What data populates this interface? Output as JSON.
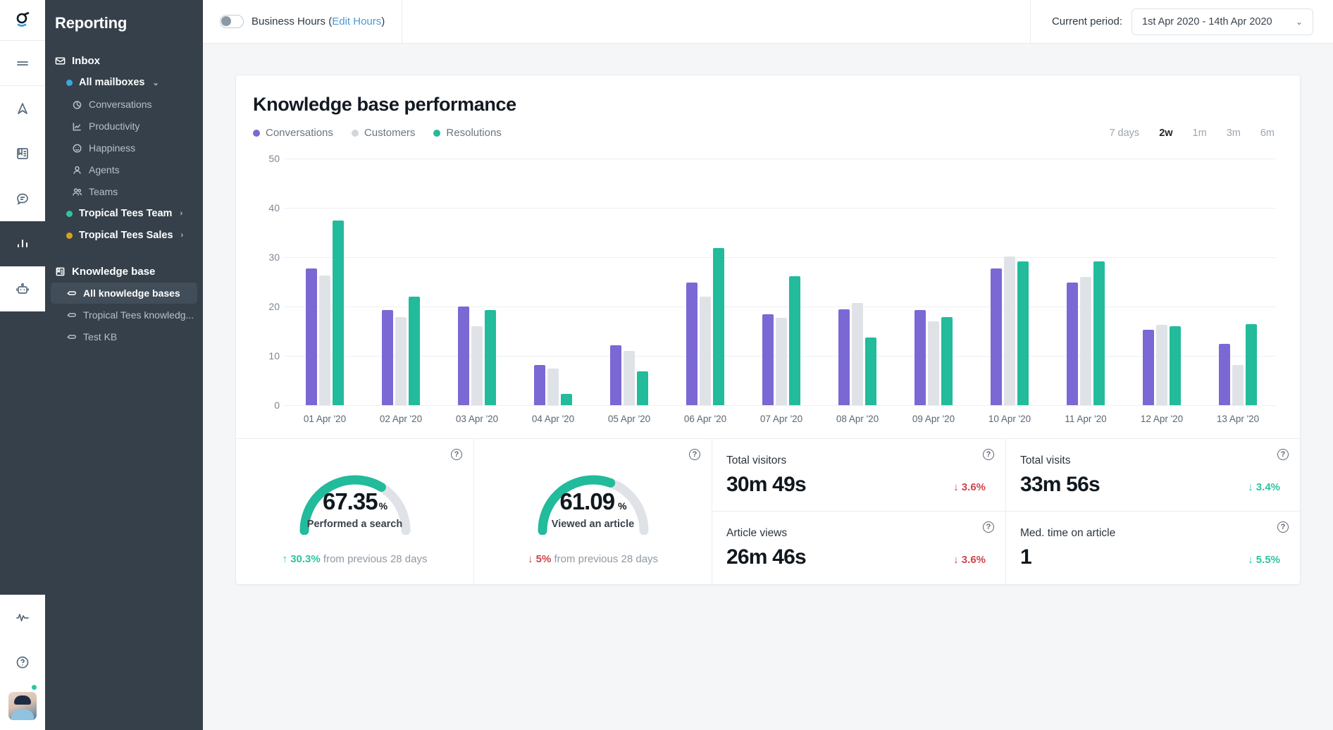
{
  "rail": {
    "items": [
      {
        "name": "logo",
        "icon": "helpscout-logo"
      },
      {
        "name": "menu",
        "icon": "hamburger-icon"
      },
      {
        "name": "navigation",
        "icon": "navigate-icon"
      },
      {
        "name": "docs",
        "icon": "book-icon"
      },
      {
        "name": "chat",
        "icon": "chat-bubble-icon"
      },
      {
        "name": "reports",
        "icon": "bar-chart-icon",
        "active": true
      },
      {
        "name": "beacon",
        "icon": "robot-icon"
      }
    ],
    "bottom": [
      {
        "name": "activity",
        "icon": "pulse-icon"
      },
      {
        "name": "help",
        "icon": "question-circle-icon"
      },
      {
        "name": "profile",
        "icon": "avatar"
      }
    ]
  },
  "sidebar": {
    "title": "Reporting",
    "inbox": {
      "label": "Inbox",
      "icon": "envelope-icon",
      "items": [
        {
          "label": "All mailboxes",
          "dot": "#3aa8e0",
          "chevron": "⌄",
          "bold": true
        },
        {
          "label": "Conversations",
          "icon": "pie-icon"
        },
        {
          "label": "Productivity",
          "icon": "line-chart-icon"
        },
        {
          "label": "Happiness",
          "icon": "smiley-icon"
        },
        {
          "label": "Agents",
          "icon": "person-icon"
        },
        {
          "label": "Teams",
          "icon": "people-icon"
        },
        {
          "label": "Tropical Tees Team",
          "dot": "#2ec4a0",
          "chevron": "›",
          "bold": true
        },
        {
          "label": "Tropical Tees Sales",
          "dot": "#d8a21e",
          "chevron": "›",
          "bold": true
        }
      ]
    },
    "kb": {
      "label": "Knowledge base",
      "icon": "book-icon",
      "items": [
        {
          "label": "All knowledge bases",
          "icon": "tag-icon",
          "selected": true
        },
        {
          "label": "Tropical Tees knowledg...",
          "icon": "tag-icon"
        },
        {
          "label": "Test KB",
          "icon": "tag-icon"
        }
      ]
    }
  },
  "topbar": {
    "business_hours_label": "Business Hours (",
    "edit_hours_link": "Edit Hours",
    "business_hours_close": ")",
    "toggle_state": "off",
    "period_label": "Current period:",
    "period_value": "1st Apr 2020  -  14th Apr 2020",
    "caret": "⌄"
  },
  "chart_data": {
    "type": "bar",
    "title": "Knowledge base performance",
    "xlabel": "",
    "ylabel": "",
    "ylim": [
      0,
      50
    ],
    "yticks": [
      50,
      40,
      30,
      20,
      10,
      0
    ],
    "grid": true,
    "legend_position": "top-left",
    "categories": [
      "01 Apr '20",
      "02 Apr '20",
      "03 Apr '20",
      "04 Apr '20",
      "05 Apr '20",
      "06 Apr '20",
      "07 Apr '20",
      "08 Apr '20",
      "09 Apr '20",
      "10 Apr '20",
      "11 Apr '20",
      "12 Apr '20",
      "13 Apr '20"
    ],
    "series": [
      {
        "name": "Conversations",
        "color": "#7b68d4",
        "values": [
          27.7,
          19.3,
          20.0,
          8.1,
          12.2,
          24.8,
          18.4,
          19.4,
          19.3,
          27.7,
          24.9,
          15.3,
          12.4
        ]
      },
      {
        "name": "Customers",
        "color": "#dfe3e8",
        "values": [
          26.3,
          17.8,
          16.0,
          7.5,
          11.0,
          22.0,
          17.7,
          20.7,
          17.0,
          30.2,
          26.0,
          16.3,
          8.2
        ]
      },
      {
        "name": "Resolutions",
        "color": "#22bb9b",
        "values": [
          37.5,
          22.0,
          19.3,
          2.3,
          6.8,
          31.8,
          26.2,
          13.7,
          17.8,
          29.2,
          29.1,
          16.0,
          16.5
        ]
      }
    ],
    "range_options": [
      "7 days",
      "2w",
      "1m",
      "3m",
      "6m"
    ],
    "range_selected": "2w"
  },
  "gauges": [
    {
      "value": "67.35",
      "unit": "%",
      "caption": "Performed a search",
      "percent": 67.35,
      "delta_arrow": "↑",
      "delta": "30.3%",
      "delta_dir": "up",
      "delta_suffix": "from previous 28 days",
      "help_icon": "question-circle-icon"
    },
    {
      "value": "61.09",
      "unit": "%",
      "caption": "Viewed an article",
      "percent": 61.09,
      "delta_arrow": "↓",
      "delta": "5%",
      "delta_dir": "down",
      "delta_suffix": "from previous 28 days",
      "help_icon": "question-circle-icon"
    }
  ],
  "stats": [
    {
      "label": "Total visitors",
      "value": "30m 49s",
      "delta": "3.6%",
      "arrow": "↓",
      "dir": "down",
      "help_icon": "question-circle-icon"
    },
    {
      "label": "Total visits",
      "value": "33m 56s",
      "delta": "3.4%",
      "arrow": "↓",
      "dir": "up",
      "help_icon": "question-circle-icon"
    },
    {
      "label": "Article views",
      "value": "26m 46s",
      "delta": "3.6%",
      "arrow": "↓",
      "dir": "down",
      "help_icon": "question-circle-icon"
    },
    {
      "label": "Med. time on article",
      "value": "1",
      "delta": "5.5%",
      "arrow": "↓",
      "dir": "up",
      "help_icon": "question-circle-icon"
    }
  ],
  "colors": {
    "conversations": "#7b68d4",
    "customers": "#dfe3e8",
    "resolutions": "#22bb9b",
    "sidebar_bg": "#36404a",
    "positive": "#2ec4a0",
    "negative": "#d0444a",
    "link": "#4a9ad4"
  }
}
